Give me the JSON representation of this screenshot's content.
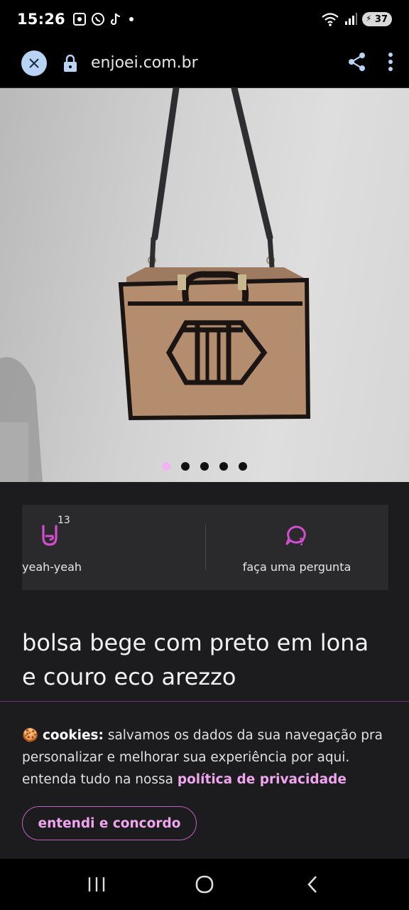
{
  "status_bar": {
    "time": "15:26",
    "battery": "37",
    "icons": [
      "screenshot-icon",
      "whatsapp-icon",
      "tiktok-icon",
      "dot-icon",
      "wifi-icon",
      "signal-icon",
      "battery-icon"
    ]
  },
  "browser": {
    "url": "enjoei.com.br",
    "icons": [
      "close-icon",
      "lock-icon",
      "share-icon",
      "more-vert-icon"
    ]
  },
  "carousel": {
    "total": 5,
    "active": 0
  },
  "actions": {
    "yeah_count": "13",
    "yeah_label": "yeah-yeah",
    "ask_label": "faça uma pergunta"
  },
  "product": {
    "title": "bolsa bege com preto em lona e couro eco arezzo"
  },
  "cookie": {
    "icon": "🍪",
    "heading": "cookies:",
    "text": " salvamos os dados da sua navegação pra personalizar e melhorar sua experiência por aqui. entenda tudo na nossa ",
    "link": "política de privacidade",
    "button": "entendi e concordo"
  },
  "colors": {
    "accent": "#f0a6ee",
    "accent_border": "#c35fc1",
    "icon_purple": "#d14fcf"
  }
}
